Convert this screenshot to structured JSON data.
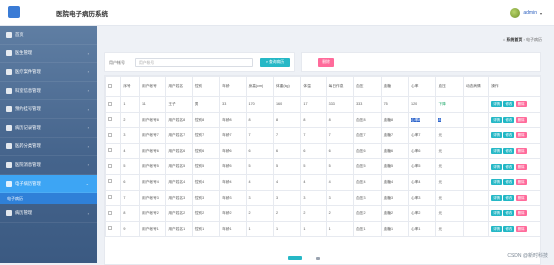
{
  "header": {
    "title": "医院电子病历系统",
    "user": "admin"
  },
  "sidebar": {
    "items": [
      {
        "label": "首页",
        "icon": "home-icon",
        "has_children": false
      },
      {
        "label": "医生管理",
        "icon": "flag-icon",
        "has_children": true
      },
      {
        "label": "医疗案件管理",
        "icon": "list-icon",
        "has_children": true
      },
      {
        "label": "科室信息管理",
        "icon": "building-icon",
        "has_children": true
      },
      {
        "label": "预约挂号管理",
        "icon": "calendar-icon",
        "has_children": true
      },
      {
        "label": "病历记录管理",
        "icon": "document-icon",
        "has_children": true
      },
      {
        "label": "医药分类管理",
        "icon": "pill-icon",
        "has_children": true
      },
      {
        "label": "医院消息管理",
        "icon": "message-icon",
        "has_children": true
      },
      {
        "label": "电子病历管理",
        "icon": "folder-icon",
        "has_children": true,
        "active": true
      },
      {
        "label": "病历管理",
        "icon": "record-icon",
        "has_children": true
      }
    ],
    "active_submenu": "电子病历"
  },
  "breadcrumb": {
    "home": "系统首页",
    "current": "电子病历"
  },
  "search": {
    "label": "用户帐号",
    "placeholder": "用户帐号",
    "button": "查询病历"
  },
  "actions": {
    "delete": "删除"
  },
  "table": {
    "headers": [
      "",
      "序号",
      "用户帐号",
      "用户姓名",
      "性别",
      "年龄",
      "身高(cm)",
      "体重(kg)",
      "体温",
      "每日作息",
      "血压",
      "血糖",
      "心率",
      "血压",
      "动态病情",
      "操作"
    ],
    "op_labels": {
      "detail": "详情",
      "edit": "修改",
      "delete": "删除"
    },
    "rows": [
      [
        "1",
        "11",
        "王子",
        "男",
        "33",
        "170",
        "160",
        "17",
        "333",
        "333",
        "75",
        "120",
        "下降",
        "",
        ""
      ],
      [
        "2",
        "用户帐号8",
        "用户姓名8",
        "性别8",
        "年龄8",
        "8",
        "8",
        "8",
        "8",
        "血压8",
        "血糖8",
        "心率8",
        "8",
        "",
        ""
      ],
      [
        "3",
        "用户帐号7",
        "用户姓名7",
        "性别7",
        "年龄7",
        "7",
        "7",
        "7",
        "7",
        "血压7",
        "血糖7",
        "心率7",
        "元",
        "",
        ""
      ],
      [
        "4",
        "用户帐号6",
        "用户姓名6",
        "性别6",
        "年龄6",
        "6",
        "6",
        "6",
        "6",
        "血压6",
        "血糖6",
        "心率6",
        "元",
        "",
        ""
      ],
      [
        "5",
        "用户帐号5",
        "用户姓名5",
        "性别5",
        "年龄5",
        "5",
        "5",
        "5",
        "5",
        "血压5",
        "血糖5",
        "心率5",
        "元",
        "",
        ""
      ],
      [
        "6",
        "用户帐号4",
        "用户姓名4",
        "性别4",
        "年龄4",
        "4",
        "4",
        "4",
        "4",
        "血压4",
        "血糖4",
        "心率4",
        "元",
        "",
        ""
      ],
      [
        "7",
        "用户帐号3",
        "用户姓名3",
        "性别3",
        "年龄3",
        "3",
        "3",
        "3",
        "3",
        "血压3",
        "血糖3",
        "心率3",
        "元",
        "",
        ""
      ],
      [
        "8",
        "用户帐号2",
        "用户姓名2",
        "性别2",
        "年龄2",
        "2",
        "2",
        "2",
        "2",
        "血压2",
        "血糖2",
        "心率2",
        "元",
        "",
        ""
      ],
      [
        "9",
        "用户帐号1",
        "用户姓名1",
        "性别1",
        "年龄1",
        "1",
        "1",
        "1",
        "1",
        "血压1",
        "血糖1",
        "心率1",
        "元",
        "",
        ""
      ]
    ]
  },
  "watermark": "CSDN @新时科技",
  "colors": {
    "accent": "#26b8c6",
    "danger": "#ff6b9b",
    "sidebar": "#45648c",
    "active": "#3da5f4"
  }
}
